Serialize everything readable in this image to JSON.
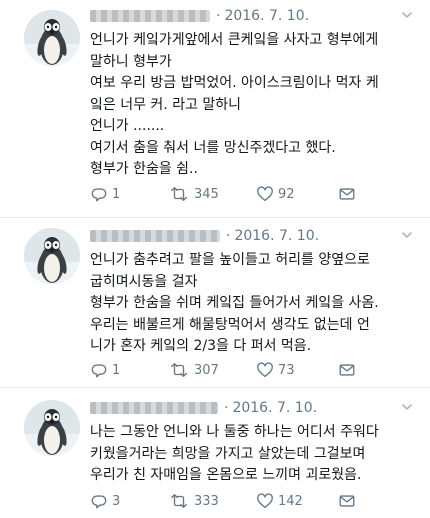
{
  "tweets": [
    {
      "date": "2016. 7. 10.",
      "lines": [
        "언니가 케잌가게앞에서 큰케잌을 사자고 형부에게",
        "말하니 형부가",
        "여보 우리 방금 밥먹었어. 아이스크림이나 먹자 케",
        "잌은 너무 커. 라고 말하니",
        "언니가 .......",
        "여기서 춤을 춰서 너를 망신주겠다고 했다.",
        "형부가 한숨을 쉼.."
      ],
      "replies": "1",
      "retweets": "345",
      "likes": "92"
    },
    {
      "date": "2016. 7. 10.",
      "lines": [
        "언니가 춤추려고  팔을 높이들고 허리를 양옆으로",
        "굽히며시동을 걸자",
        "형부가 한숨을 쉬며 케잌집 들어가서 케잌을 사옴.",
        "우리는 배불르게 해물탕먹어서 생각도 없는데 언",
        "니가 혼자 케잌의 2/3을 다 퍼서 먹음."
      ],
      "replies": "1",
      "retweets": "307",
      "likes": "73"
    },
    {
      "date": "2016. 7. 10.",
      "lines": [
        "나는 그동안 언니와 나 둘중 하나는 어디서 주워다",
        "키웠을거라는 희망을 가지고 살았는데  그걸보며",
        "우리가 친 자매임을 온몸으로 느끼며 괴로웠음."
      ],
      "replies": "3",
      "retweets": "333",
      "likes": "142"
    }
  ],
  "colors": {
    "text": "#14171a",
    "meta": "#657786",
    "divider": "#e6ecf0"
  },
  "icons": [
    "penguin-avatar",
    "chevron-down-icon",
    "reply-icon",
    "retweet-icon",
    "heart-icon",
    "direct-message-icon"
  ]
}
